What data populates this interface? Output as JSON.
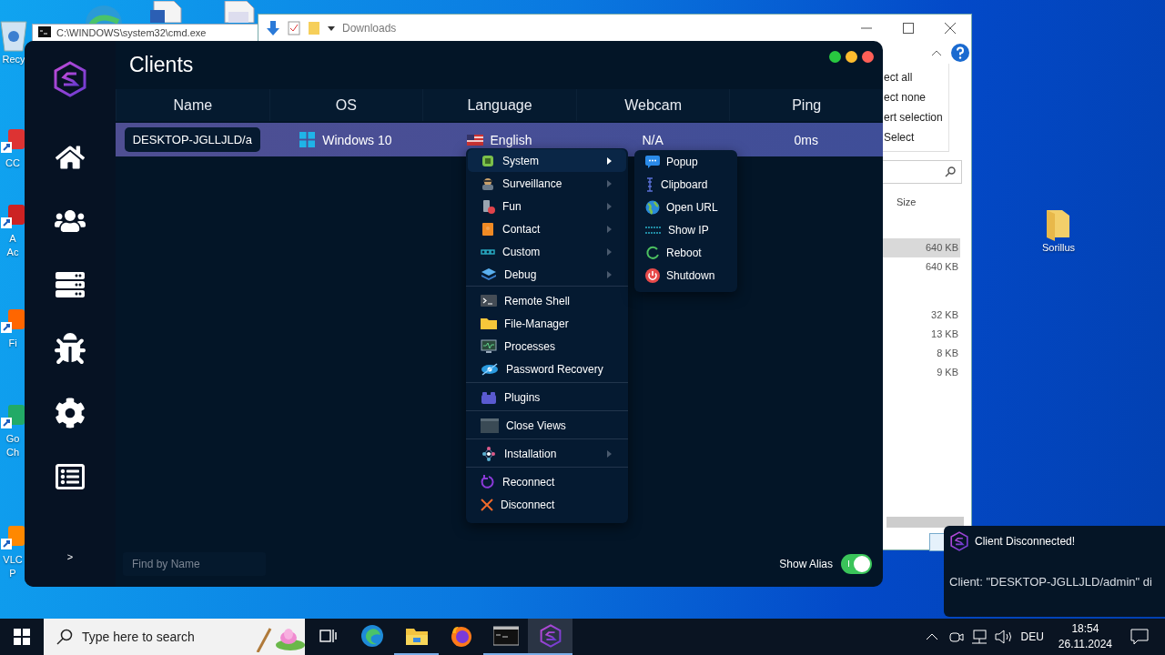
{
  "desktop": {
    "icons": [
      {
        "lines": [
          "Recy"
        ]
      },
      {
        "lines": [
          "CC"
        ]
      },
      {
        "lines": [
          "A",
          "Ac"
        ]
      },
      {
        "lines": [
          "Fi"
        ]
      },
      {
        "lines": [
          "Go",
          "Ch"
        ]
      },
      {
        "lines": [
          "VLC",
          "P"
        ]
      },
      {
        "lines": [
          "Sorillus"
        ]
      }
    ]
  },
  "cmd_window": {
    "title": "C:\\WINDOWS\\system32\\cmd.exe"
  },
  "explorer": {
    "path": "Downloads",
    "ribbon": [
      "ect all",
      "ect none",
      "ert selection",
      "Select"
    ],
    "size_header": "Size",
    "sizes": [
      {
        "text": "640 KB",
        "selected": true
      },
      {
        "text": "640 KB",
        "selected": false
      },
      {
        "text": "32 KB",
        "selected": false
      },
      {
        "text": "13 KB",
        "selected": false
      },
      {
        "text": "8 KB",
        "selected": false
      },
      {
        "text": "9 KB",
        "selected": false
      }
    ]
  },
  "app": {
    "title": "Clients",
    "columns": [
      "Name",
      "OS",
      "Language",
      "Webcam",
      "Ping"
    ],
    "rows": [
      {
        "name": "DESKTOP-JGLLJLD/a",
        "os": "Windows 10",
        "language": "English",
        "webcam": "N/A",
        "ping": "0ms",
        "selected": true
      }
    ],
    "expand": ">",
    "search": {
      "placeholder": "Find by Name"
    },
    "show_alias": {
      "label": "Show Alias",
      "on": true
    }
  },
  "context_menu": {
    "groups": [
      [
        {
          "label": "System",
          "submenu": true,
          "selected": true
        },
        {
          "label": "Surveillance",
          "submenu": true,
          "selected": false
        },
        {
          "label": "Fun",
          "submenu": true,
          "selected": false
        },
        {
          "label": "Contact",
          "submenu": true,
          "selected": false
        },
        {
          "label": "Custom",
          "submenu": true,
          "selected": false
        },
        {
          "label": "Debug",
          "submenu": true,
          "selected": false
        }
      ],
      [
        {
          "label": "Remote Shell",
          "submenu": false,
          "selected": false
        },
        {
          "label": "File-Manager",
          "submenu": false,
          "selected": false
        },
        {
          "label": "Processes",
          "submenu": false,
          "selected": false
        },
        {
          "label": "Password Recovery",
          "submenu": false,
          "selected": false
        }
      ],
      [
        {
          "label": "Plugins",
          "submenu": false,
          "selected": false
        }
      ],
      [
        {
          "label": "Close Views",
          "submenu": false,
          "selected": false
        }
      ],
      [
        {
          "label": "Installation",
          "submenu": true,
          "selected": false
        }
      ],
      [
        {
          "label": "Reconnect",
          "submenu": false,
          "selected": false
        },
        {
          "label": "Disconnect",
          "submenu": false,
          "selected": false
        }
      ]
    ]
  },
  "submenu": {
    "items": [
      "Popup",
      "Clipboard",
      "Open URL",
      "Show IP",
      "Reboot",
      "Shutdown"
    ]
  },
  "notification": {
    "title": "Client Disconnected!",
    "message": "Client: \"DESKTOP-JGLLJLD/admin\" di"
  },
  "taskbar": {
    "search_placeholder": "Type here to search",
    "apps": [
      {
        "running": false,
        "active": false
      },
      {
        "running": false,
        "active": false
      },
      {
        "running": true,
        "active": false
      },
      {
        "running": false,
        "active": false
      },
      {
        "running": true,
        "active": false
      },
      {
        "running": true,
        "active": true
      }
    ],
    "language": "DEU",
    "time": "18:54",
    "date": "26.11.2024"
  }
}
